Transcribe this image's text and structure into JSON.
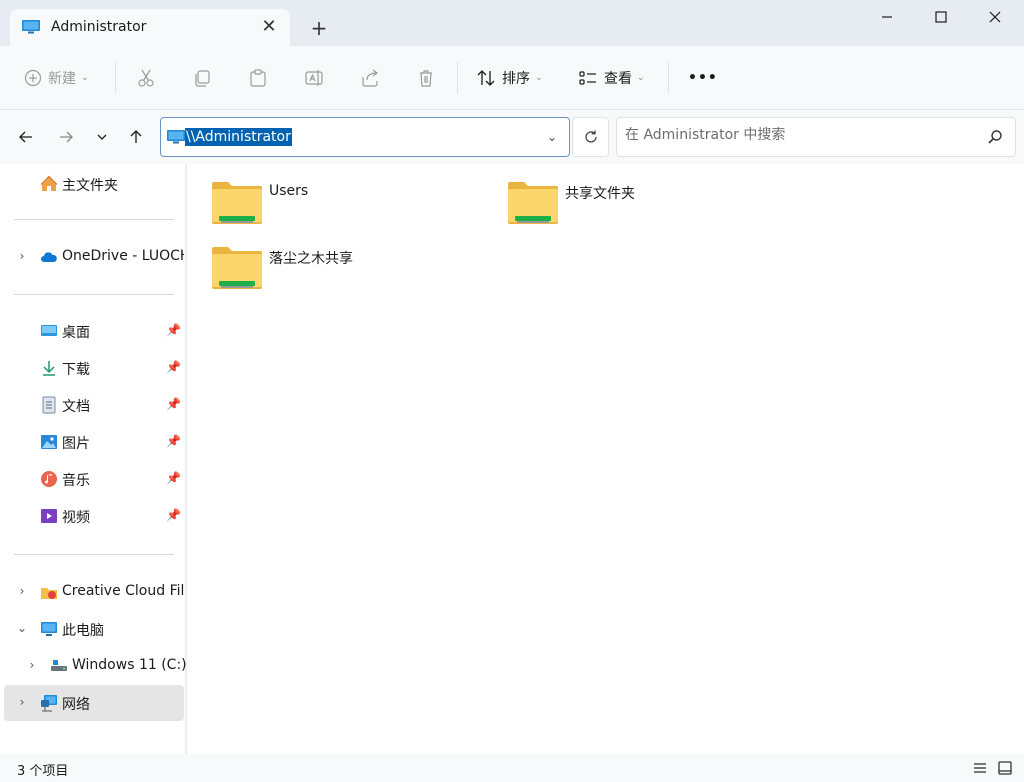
{
  "window": {
    "tab_title": "Administrator",
    "tab_close": "✕",
    "new_tab": "+"
  },
  "toolbar": {
    "new_label": "新建",
    "sort_label": "排序",
    "view_label": "查看",
    "more": "•••"
  },
  "address": {
    "path": "\\\\Administrator",
    "search_placeholder": "在 Administrator 中搜索"
  },
  "sidebar": {
    "home": "主文件夹",
    "onedrive": "OneDrive - LUOCH",
    "quick": [
      {
        "label": "桌面"
      },
      {
        "label": "下载"
      },
      {
        "label": "文档"
      },
      {
        "label": "图片"
      },
      {
        "label": "音乐"
      },
      {
        "label": "视频"
      }
    ],
    "creative_cloud": "Creative Cloud Files",
    "this_pc": "此电脑",
    "windows_drive": "Windows 11 (C:)",
    "network": "网络"
  },
  "content": {
    "items": [
      {
        "name": "Users"
      },
      {
        "name": "共享文件夹"
      },
      {
        "name": "落尘之木共享"
      }
    ]
  },
  "status": {
    "count": "3 个项目"
  }
}
